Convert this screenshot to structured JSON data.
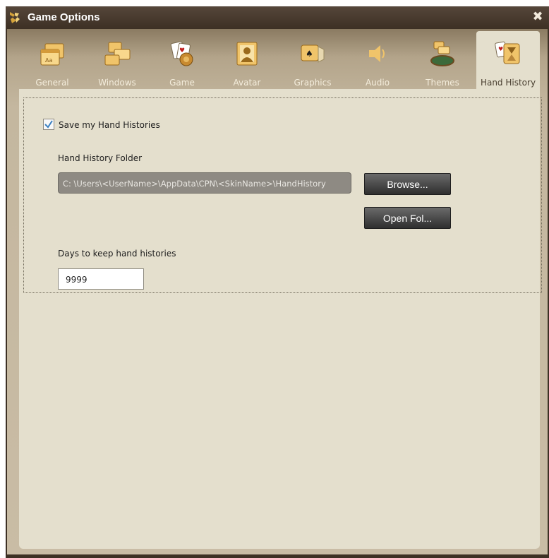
{
  "window": {
    "title": "Game Options",
    "close_glyph": "✖"
  },
  "tabs": [
    {
      "label": "General",
      "icon": "general-icon"
    },
    {
      "label": "Windows",
      "icon": "windows-icon"
    },
    {
      "label": "Game",
      "icon": "game-icon"
    },
    {
      "label": "Avatar",
      "icon": "avatar-icon"
    },
    {
      "label": "Graphics",
      "icon": "graphics-icon"
    },
    {
      "label": "Audio",
      "icon": "audio-icon"
    },
    {
      "label": "Themes",
      "icon": "themes-icon"
    },
    {
      "label": "Hand History",
      "icon": "hand-history-icon",
      "active": true
    }
  ],
  "hand_history": {
    "save_checkbox_label": "Save my Hand Histories",
    "save_checked": true,
    "folder_label": "Hand History Folder",
    "folder_path": "C: \\Users\\<UserName>\\AppData\\CPN\\<SkinName>\\HandHistory",
    "browse_button": "Browse...",
    "open_folder_button": "Open Fol...",
    "days_label": "Days to keep hand histories",
    "days_value": "9999"
  },
  "colors": {
    "titlebar": "#3d3024",
    "frame": "#c9bca5",
    "panel": "#e4dfcd",
    "button": "#3a3a3a"
  }
}
